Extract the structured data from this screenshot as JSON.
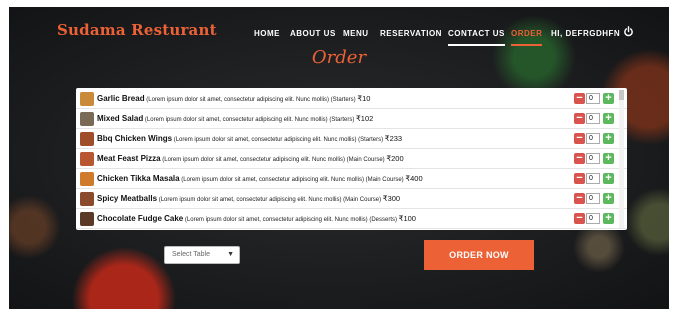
{
  "header": {
    "brand": "Sudama Resturant",
    "nav": [
      {
        "label": "HOME",
        "active": false
      },
      {
        "label": "ABOUT US",
        "active": false
      },
      {
        "label": "MENU",
        "active": false
      },
      {
        "label": "RESERVATION",
        "active": false
      },
      {
        "label": "CONTACT US",
        "active": false,
        "underlined": true
      },
      {
        "label": "ORDER",
        "active": true
      },
      {
        "label": "HI, DEFRGDHFN",
        "active": false
      }
    ],
    "logout_icon": "power-icon"
  },
  "page_title": "Order",
  "order_items": [
    {
      "name": "Garlic Bread",
      "description": "(Lorem ipsum dolor sit amet, consectetur adipiscing elit. Nunc mollis) (Starters)",
      "price": "₹10",
      "qty": "0",
      "thumb_color": "#c98a3a"
    },
    {
      "name": "Mixed Salad",
      "description": "(Lorem ipsum dolor sit amet, consectetur adipiscing elit. Nunc mollis) (Starters)",
      "price": "₹102",
      "qty": "0",
      "thumb_color": "#7a6a55"
    },
    {
      "name": "Bbq Chicken Wings",
      "description": "(Lorem ipsum dolor sit amet, consectetur adipiscing elit. Nunc mollis) (Starters)",
      "price": "₹233",
      "qty": "0",
      "thumb_color": "#a04d2a"
    },
    {
      "name": "Meat Feast Pizza",
      "description": "(Lorem ipsum dolor sit amet, consectetur adipiscing elit. Nunc mollis) (Main Course)",
      "price": "₹200",
      "qty": "0",
      "thumb_color": "#b8562f"
    },
    {
      "name": "Chicken Tikka Masala",
      "description": "(Lorem ipsum dolor sit amet, consectetur adipiscing elit. Nunc mollis) (Main Course)",
      "price": "₹400",
      "qty": "0",
      "thumb_color": "#d07a2c"
    },
    {
      "name": "Spicy Meatballs",
      "description": "(Lorem ipsum dolor sit amet, consectetur adipiscing elit. Nunc mollis) (Main Course)",
      "price": "₹300",
      "qty": "0",
      "thumb_color": "#8c4a2c"
    },
    {
      "name": "Chocolate Fudge Cake",
      "description": "(Lorem ipsum dolor sit amet, consectetur adipiscing elit. Nunc mollis) (Desserts)",
      "price": "₹100",
      "qty": "0",
      "thumb_color": "#5a3a26"
    }
  ],
  "controls": {
    "minus": "−",
    "plus": "+"
  },
  "select_table": {
    "value": "Select Table"
  },
  "order_button": "ORDER NOW",
  "colors": {
    "accent": "#ec6136",
    "minus": "#d9534f",
    "plus": "#5cb85c"
  }
}
